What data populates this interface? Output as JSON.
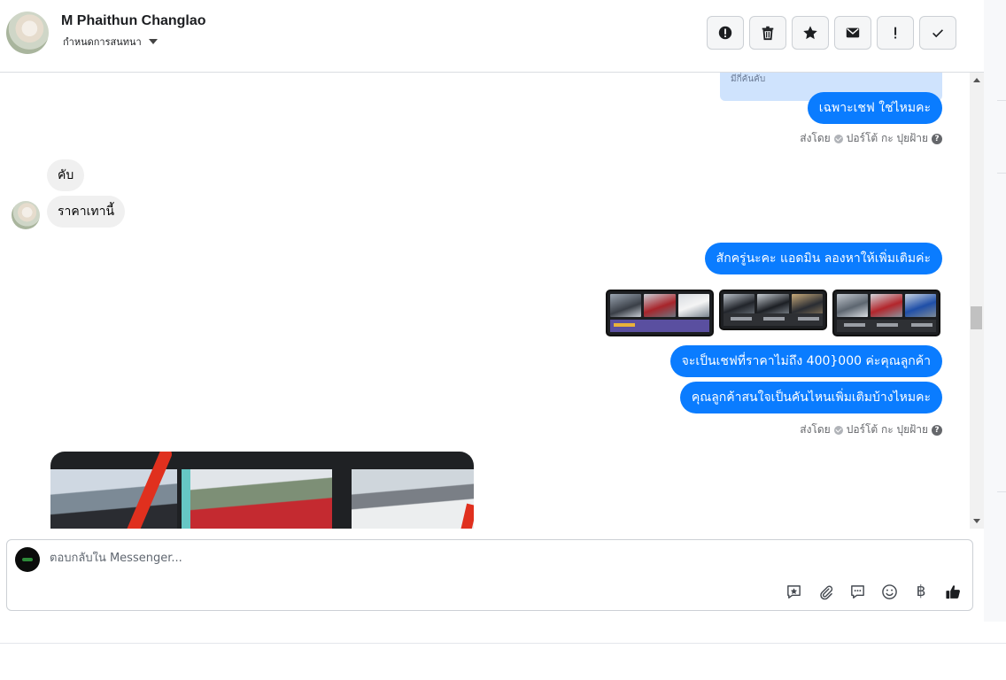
{
  "header": {
    "contact_name": "M Phaithun Changlao",
    "assign_label": "กำหนดการสนทนา",
    "actions": [
      {
        "icon": "alert-circle-icon",
        "label": "Mark as spam"
      },
      {
        "icon": "trash-icon",
        "label": "Delete"
      },
      {
        "icon": "star-icon",
        "label": "Star"
      },
      {
        "icon": "envelope-icon",
        "label": "Mark unread"
      },
      {
        "icon": "exclamation-icon",
        "label": "Follow up"
      },
      {
        "icon": "check-icon",
        "label": "Done"
      }
    ]
  },
  "chat": {
    "quoted_snippet": "มีกี่คันคับ",
    "messages": {
      "out_1": "เฉพาะเชฟ ใช่ไหมคะ",
      "sent_by_1": {
        "prefix": "ส่งโดย",
        "agent": "ปอร์โต้ กะ ปุยฝ้าย"
      },
      "in_1": "คับ",
      "in_2": "ราคาเทานี้",
      "out_2": "สักครู่นะคะ แอดมิน ลองหาให้เพิ่มเติมค่ะ",
      "out_3": "จะเป็นเชฟที่ราคาไม่ถึง 400}000 ค่ะคุณลูกค้า",
      "out_4": "คุณลูกค้าสนใจเป็นคันไหนเพิ่มเติมบ้างไหมคะ",
      "sent_by_2": {
        "prefix": "ส่งโดย",
        "agent": "ปอร์โต้ กะ ปุยฝ้าย"
      },
      "help_mark": "?"
    },
    "attachments": {
      "thumbnail_count": 3,
      "large_image_count": 1
    }
  },
  "composer": {
    "placeholder": "ตอบกลับใน Messenger...",
    "tools": [
      "saved-reply-icon",
      "paperclip-icon",
      "chat-bubble-icon",
      "smiley-icon",
      "baht-icon",
      "thumbs-up-icon"
    ],
    "baht_symbol": "฿"
  },
  "colors": {
    "outgoing_bubble": "#0a7cff",
    "incoming_bubble": "#f0f0f0",
    "quoted_bg": "#cfe3fd"
  }
}
